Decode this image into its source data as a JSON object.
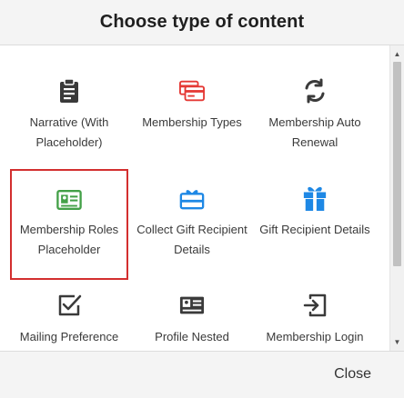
{
  "dialog": {
    "title": "Choose type of content",
    "close_label": "Close"
  },
  "tiles": [
    {
      "label": "Narrative (With Placeholder)",
      "icon": "clipboard-icon",
      "color": "#3a3a3a"
    },
    {
      "label": "Membership Types",
      "icon": "cards-icon",
      "color": "#e53935"
    },
    {
      "label": "Membership Auto Renewal",
      "icon": "refresh-icon",
      "color": "#3a3a3a"
    },
    {
      "label": "Membership Roles Placeholder",
      "icon": "id-card-icon",
      "color": "#43a047",
      "selected": true
    },
    {
      "label": "Collect Gift Recipient Details",
      "icon": "gift-card-icon",
      "color": "#1e88e5"
    },
    {
      "label": "Gift Recipient Details",
      "icon": "gift-icon",
      "color": "#1e88e5"
    },
    {
      "label": "Mailing Preference",
      "icon": "checkbox-icon",
      "color": "#3a3a3a"
    },
    {
      "label": "Profile Nested",
      "icon": "profile-card-icon",
      "color": "#3a3a3a"
    },
    {
      "label": "Membership Login",
      "icon": "sign-in-icon",
      "color": "#3a3a3a"
    }
  ],
  "colors": {
    "selected_border": "#d32f2f",
    "header_bg": "#f4f4f4"
  }
}
